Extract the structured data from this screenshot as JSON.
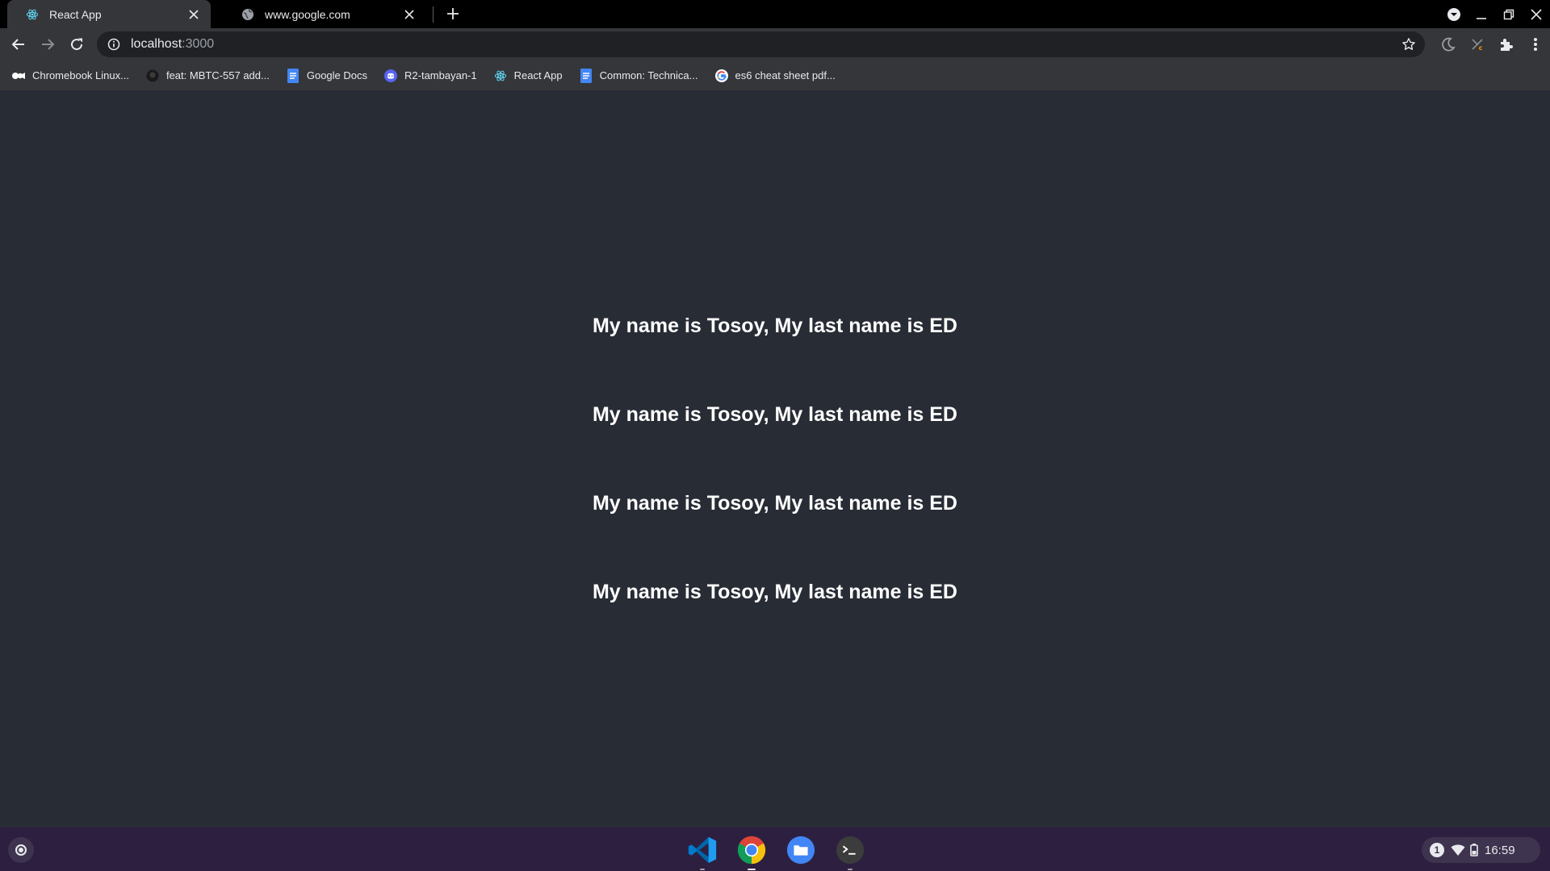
{
  "tabs": [
    {
      "title": "React App",
      "icon": "react-icon",
      "active": true
    },
    {
      "title": "www.google.com",
      "icon": "globe-icon",
      "active": false
    }
  ],
  "toolbar": {
    "url_host": "localhost",
    "url_port": ":3000"
  },
  "bookmarks": [
    {
      "label": "Chromebook Linux...",
      "icon": "video-camera-icon"
    },
    {
      "label": "feat: MBTC-557 add...",
      "icon": "github-icon"
    },
    {
      "label": "Google Docs",
      "icon": "docs-icon"
    },
    {
      "label": "R2-tambayan-1",
      "icon": "discord-icon"
    },
    {
      "label": "React App",
      "icon": "react-icon"
    },
    {
      "label": "Common: Technica...",
      "icon": "docs-icon"
    },
    {
      "label": "es6 cheat sheet pdf...",
      "icon": "google-g-icon"
    }
  ],
  "page": {
    "lines": [
      "My name is Tosoy, My last name is ED",
      "My name is Tosoy, My last name is ED",
      "My name is Tosoy, My last name is ED",
      "My name is Tosoy, My last name is ED"
    ]
  },
  "shelf": {
    "apps": [
      "vscode-icon",
      "chrome-icon",
      "files-icon",
      "terminal-icon"
    ],
    "notification_count": "1",
    "time": "16:59"
  },
  "colors": {
    "page_bg": "#282c34",
    "shelf_bg": "#2d1f3f",
    "tab_active_bg": "#35363a"
  }
}
